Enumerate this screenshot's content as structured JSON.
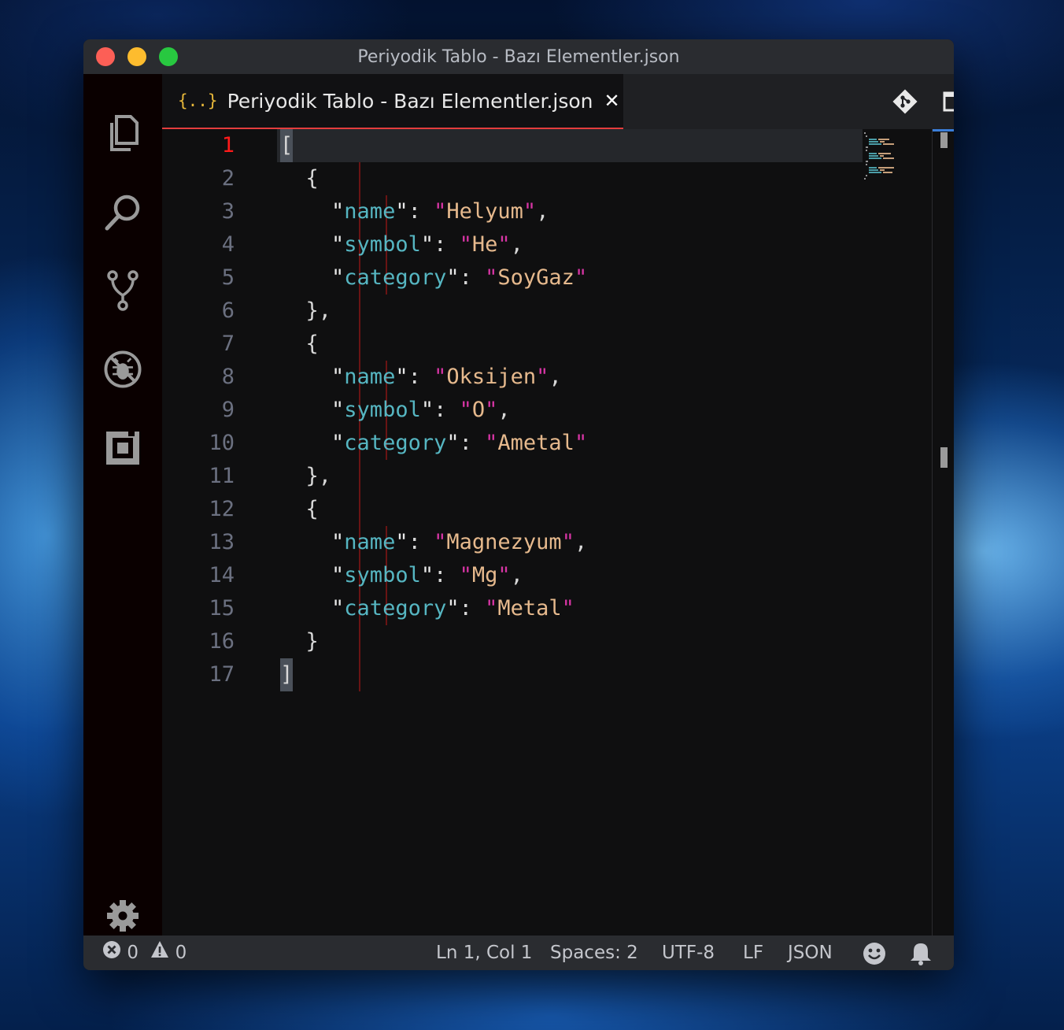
{
  "window": {
    "title": "Periyodik Tablo - Bazı Elementler.json"
  },
  "activity_bar": {
    "items": [
      "explorer-icon",
      "search-icon",
      "source-control-icon",
      "debug-icon",
      "extensions-icon"
    ],
    "bottom": "settings-gear-icon"
  },
  "tab": {
    "icon_text": "{..}",
    "label": "Periyodik Tablo - Bazı Elementler.json",
    "close": "✕"
  },
  "tab_actions": [
    "git-compare-icon",
    "split-editor-icon",
    "more-actions-icon"
  ],
  "editor": {
    "active_line": 1,
    "lines": [
      {
        "n": "1",
        "text": "["
      },
      {
        "n": "2",
        "text": "  {"
      },
      {
        "n": "3",
        "key": "name",
        "value": "Helyum",
        "comma": ","
      },
      {
        "n": "4",
        "key": "symbol",
        "value": "He",
        "comma": ","
      },
      {
        "n": "5",
        "key": "category",
        "value": "SoyGaz",
        "comma": ""
      },
      {
        "n": "6",
        "text": "  },"
      },
      {
        "n": "7",
        "text": "  {"
      },
      {
        "n": "8",
        "key": "name",
        "value": "Oksijen",
        "comma": ","
      },
      {
        "n": "9",
        "key": "symbol",
        "value": "O",
        "comma": ","
      },
      {
        "n": "10",
        "key": "category",
        "value": "Ametal",
        "comma": ""
      },
      {
        "n": "11",
        "text": "  },"
      },
      {
        "n": "12",
        "text": "  {"
      },
      {
        "n": "13",
        "key": "name",
        "value": "Magnezyum",
        "comma": ","
      },
      {
        "n": "14",
        "key": "symbol",
        "value": "Mg",
        "comma": ","
      },
      {
        "n": "15",
        "key": "category",
        "value": "Metal",
        "comma": ""
      },
      {
        "n": "16",
        "text": "  }"
      },
      {
        "n": "17",
        "text": "]"
      }
    ]
  },
  "status_bar": {
    "errors": "0",
    "warnings": "0",
    "cursor": "Ln 1, Col 1",
    "spaces": "Spaces: 2",
    "encoding": "UTF-8",
    "eol": "LF",
    "language": "JSON"
  },
  "colors": {
    "key": "#56b6c2",
    "string_quote": "#d935a6",
    "string_value": "#e6b98d",
    "active_line_number": "#ff1a1a",
    "tab_underline": "#e43d3d"
  }
}
